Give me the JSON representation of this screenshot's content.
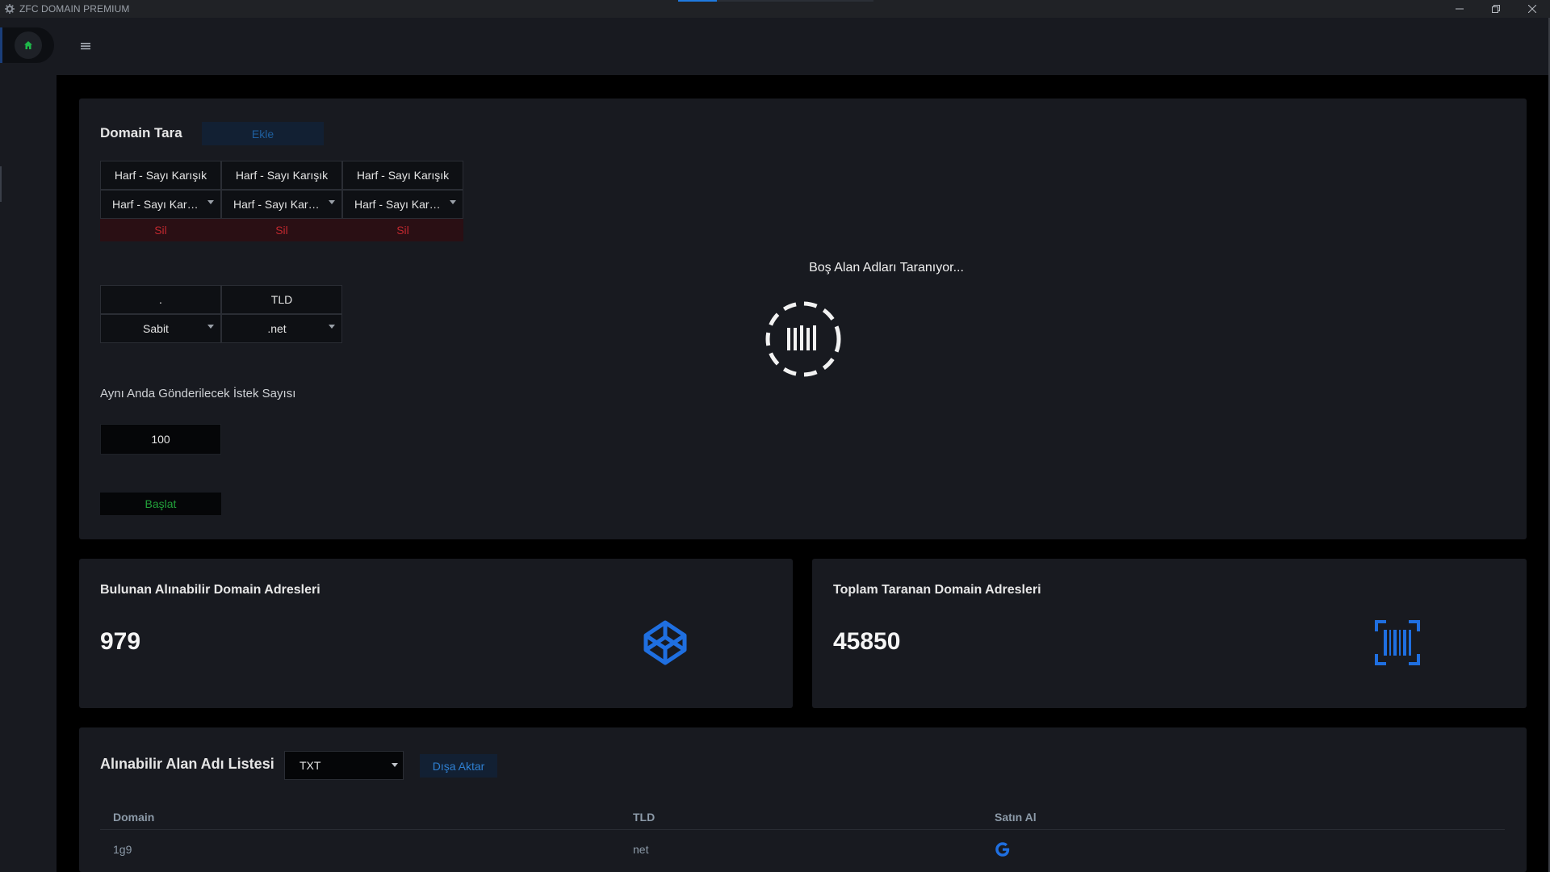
{
  "window": {
    "title": "ZFC DOMAIN PREMIUM"
  },
  "colors": {
    "accent": "#1f6fe0",
    "danger": "#c0282f",
    "success": "#22a03a",
    "panel": "#181a20"
  },
  "scan": {
    "title": "Domain Tara",
    "add_label": "Ekle",
    "pattern_headers": [
      "Harf - Sayı Karışık",
      "Harf - Sayı Karışık",
      "Harf - Sayı Karışık"
    ],
    "pattern_selects": [
      "Harf - Sayı Karışık",
      "Harf - Sayı Karışık",
      "Harf - Sayı Karışık"
    ],
    "delete_label": "Sil",
    "tld_headers": [
      ".",
      "TLD"
    ],
    "tld_selects": [
      "Sabit",
      ".net"
    ],
    "request_label": "Aynı Anda Gönderilecek İstek Sayısı",
    "request_value": "100",
    "start_label": "Başlat",
    "loading_text": "Boş Alan Adları Taranıyor..."
  },
  "stats": {
    "found_title": "Bulunan Alınabilir Domain Adresleri",
    "found_value": "979",
    "found_icon": "codepen-icon",
    "total_title": "Toplam Taranan Domain Adresleri",
    "total_value": "45850",
    "total_icon": "barcode-scan-icon"
  },
  "list": {
    "title": "Alınabilir Alan Adı Listesi",
    "format": "TXT",
    "export_label": "Dışa Aktar",
    "columns": [
      "Domain",
      "TLD",
      "Satın Al"
    ],
    "rows": [
      {
        "domain": "1g9",
        "tld": "net",
        "buy_icon": "google-icon"
      }
    ]
  }
}
